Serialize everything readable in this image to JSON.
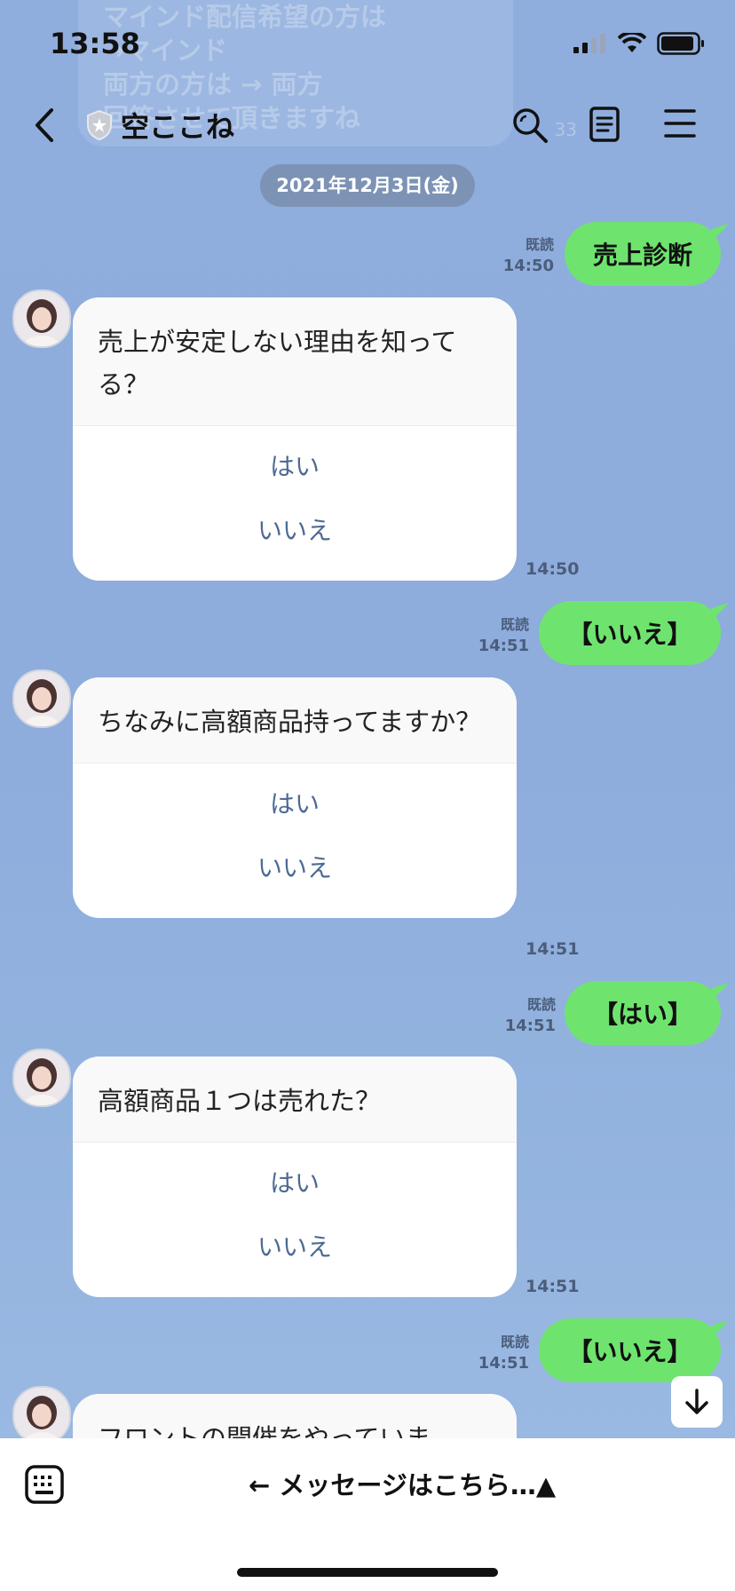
{
  "status": {
    "time": "13:58"
  },
  "ghost_lines": [
    "マインド配信希望の方は",
    "→マインド",
    "両方の方は → 両方",
    "回答させて頂きますね"
  ],
  "ghost_time": "33",
  "header": {
    "title": "空ここね"
  },
  "date_pill": "2021年12月3日(金)",
  "messages": [
    {
      "type": "out",
      "text": "売上診断",
      "read": "既読",
      "time": "14:50"
    },
    {
      "type": "card",
      "question": "売上が安定しない理由を知ってる？",
      "options": [
        "はい",
        "いいえ"
      ],
      "time": "14:50"
    },
    {
      "type": "out",
      "text": "【いいえ】",
      "read": "既読",
      "time": "14:51"
    },
    {
      "type": "card",
      "question": "ちなみに高額商品持ってますか？",
      "options": [
        "はい",
        "いいえ"
      ],
      "time": "14:51"
    },
    {
      "type": "out",
      "text": "【はい】",
      "read": "既読",
      "time": "14:51"
    },
    {
      "type": "card",
      "question": "高額商品１つは売れた？",
      "options": [
        "はい",
        "いいえ"
      ],
      "time": "14:51"
    },
    {
      "type": "out",
      "text": "【いいえ】",
      "read": "既読",
      "time": "14:51"
    },
    {
      "type": "card",
      "question": "フロントの開催をやっていま",
      "options": [],
      "time": ""
    }
  ],
  "footer": {
    "prompt": "← メッセージはこちら…▲"
  },
  "colors": {
    "out_bubble": "#6ee46f",
    "background": "#8faedd",
    "option_text": "#4d6a93"
  }
}
